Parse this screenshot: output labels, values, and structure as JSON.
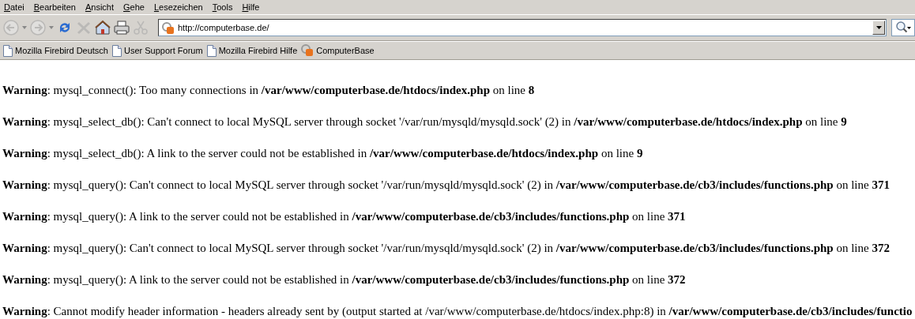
{
  "menu": [
    {
      "accel": "D",
      "rest": "atei"
    },
    {
      "accel": "B",
      "rest": "earbeiten"
    },
    {
      "accel": "A",
      "rest": "nsicht"
    },
    {
      "accel": "G",
      "rest": "ehe"
    },
    {
      "accel": "L",
      "rest": "esezeichen"
    },
    {
      "accel": "T",
      "rest": "ools"
    },
    {
      "accel": "H",
      "rest": "ilfe"
    }
  ],
  "toolbar": [
    {
      "kind": "back",
      "disabled": true
    },
    {
      "kind": "forward",
      "disabled": true
    },
    {
      "kind": "reload",
      "disabled": false
    },
    {
      "kind": "stop",
      "disabled": true
    },
    {
      "kind": "home",
      "disabled": false
    },
    {
      "kind": "print",
      "disabled": false
    },
    {
      "kind": "cut",
      "disabled": true
    }
  ],
  "address": {
    "value": "http://computerbase.de/"
  },
  "bookmarks": [
    {
      "label": "Mozilla Firebird Deutsch",
      "kind": "page"
    },
    {
      "label": "User Support Forum",
      "kind": "page"
    },
    {
      "label": "Mozilla Firebird Hilfe",
      "kind": "page"
    },
    {
      "label": "ComputerBase",
      "kind": "site"
    }
  ],
  "messages": [
    "**Warning**: mysql_connect(): Too many connections in **/var/www/computerbase.de/htdocs/index.php** on line **8**",
    "**Warning**: mysql_select_db(): Can't connect to local MySQL server through socket '/var/run/mysqld/mysqld.sock' (2) in **/var/www/computerbase.de/htdocs/index.php** on line **9**",
    "**Warning**: mysql_select_db(): A link to the server could not be established in **/var/www/computerbase.de/htdocs/index.php** on line **9**",
    "**Warning**: mysql_query(): Can't connect to local MySQL server through socket '/var/run/mysqld/mysqld.sock' (2) in **/var/www/computerbase.de/cb3/includes/functions.php** on line **371**",
    "**Warning**: mysql_query(): A link to the server could not be established in **/var/www/computerbase.de/cb3/includes/functions.php** on line **371**",
    "**Warning**: mysql_query(): Can't connect to local MySQL server through socket '/var/run/mysqld/mysqld.sock' (2) in **/var/www/computerbase.de/cb3/includes/functions.php** on line **372**",
    "**Warning**: mysql_query(): A link to the server could not be established in **/var/www/computerbase.de/cb3/includes/functions.php** on line **372**",
    "**Warning**: Cannot modify header information - headers already sent by (output started at /var/www/computerbase.de/htdocs/index.php:8) in **/var/www/computerbase.de/cb3/includes/functio**"
  ]
}
